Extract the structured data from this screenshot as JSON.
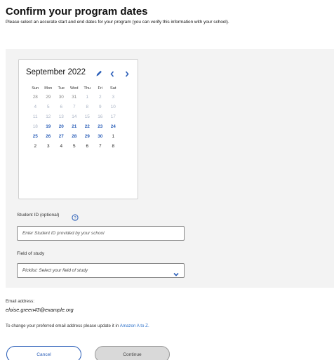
{
  "header": {
    "title": "Confirm your program dates",
    "subtitle": "Please select an accurate start and end dates for your program (you can verify this information with your school)."
  },
  "calendar": {
    "month_label": "September 2022",
    "weekdays": [
      "Sun",
      "Mon",
      "Tue",
      "Wed",
      "Thu",
      "Fri",
      "Sat"
    ],
    "weeks": [
      [
        {
          "d": "28",
          "s": "out"
        },
        {
          "d": "29",
          "s": "out"
        },
        {
          "d": "30",
          "s": "out"
        },
        {
          "d": "31",
          "s": "out"
        },
        {
          "d": "1",
          "s": "dis"
        },
        {
          "d": "2",
          "s": "dis"
        },
        {
          "d": "3",
          "s": "dis"
        }
      ],
      [
        {
          "d": "4",
          "s": "dis"
        },
        {
          "d": "5",
          "s": "dis"
        },
        {
          "d": "6",
          "s": "dis"
        },
        {
          "d": "7",
          "s": "dis"
        },
        {
          "d": "8",
          "s": "dis"
        },
        {
          "d": "9",
          "s": "dis"
        },
        {
          "d": "10",
          "s": "dis"
        }
      ],
      [
        {
          "d": "11",
          "s": "dis"
        },
        {
          "d": "12",
          "s": "dis"
        },
        {
          "d": "13",
          "s": "dis"
        },
        {
          "d": "14",
          "s": "dis"
        },
        {
          "d": "15",
          "s": "dis"
        },
        {
          "d": "16",
          "s": "dis"
        },
        {
          "d": "17",
          "s": "dis"
        }
      ],
      [
        {
          "d": "18",
          "s": "dis"
        },
        {
          "d": "19",
          "s": "sel"
        },
        {
          "d": "20",
          "s": "sel"
        },
        {
          "d": "21",
          "s": "sel"
        },
        {
          "d": "22",
          "s": "sel"
        },
        {
          "d": "23",
          "s": "sel"
        },
        {
          "d": "24",
          "s": "sel"
        }
      ],
      [
        {
          "d": "25",
          "s": "sel"
        },
        {
          "d": "26",
          "s": "sel"
        },
        {
          "d": "27",
          "s": "sel"
        },
        {
          "d": "28",
          "s": "sel"
        },
        {
          "d": "29",
          "s": "sel"
        },
        {
          "d": "30",
          "s": "sel"
        },
        {
          "d": "1",
          "s": "norm"
        }
      ],
      [
        {
          "d": "2",
          "s": "norm"
        },
        {
          "d": "3",
          "s": "norm"
        },
        {
          "d": "4",
          "s": "norm"
        },
        {
          "d": "5",
          "s": "norm"
        },
        {
          "d": "6",
          "s": "norm"
        },
        {
          "d": "7",
          "s": "norm"
        },
        {
          "d": "8",
          "s": "norm"
        }
      ]
    ]
  },
  "student_id": {
    "label": "Student ID (optional)",
    "value": "",
    "placeholder": "Enter Student ID provided by your school"
  },
  "field_of_study": {
    "label": "Field of study",
    "selected": "Picklist: Select your field of study"
  },
  "email": {
    "label": "Email address:",
    "value": "eloise.green43@example.org"
  },
  "change_note": {
    "text": "To change your preferred email address please update it in ",
    "link": "Amazon A to Z."
  },
  "buttons": {
    "cancel": "Cancel",
    "continue": "Continue"
  },
  "colors": {
    "accent": "#2a5eb8",
    "link": "#2a6fc9",
    "panel": "#f3f3f3",
    "disabled_button": "#d9d9d9"
  }
}
